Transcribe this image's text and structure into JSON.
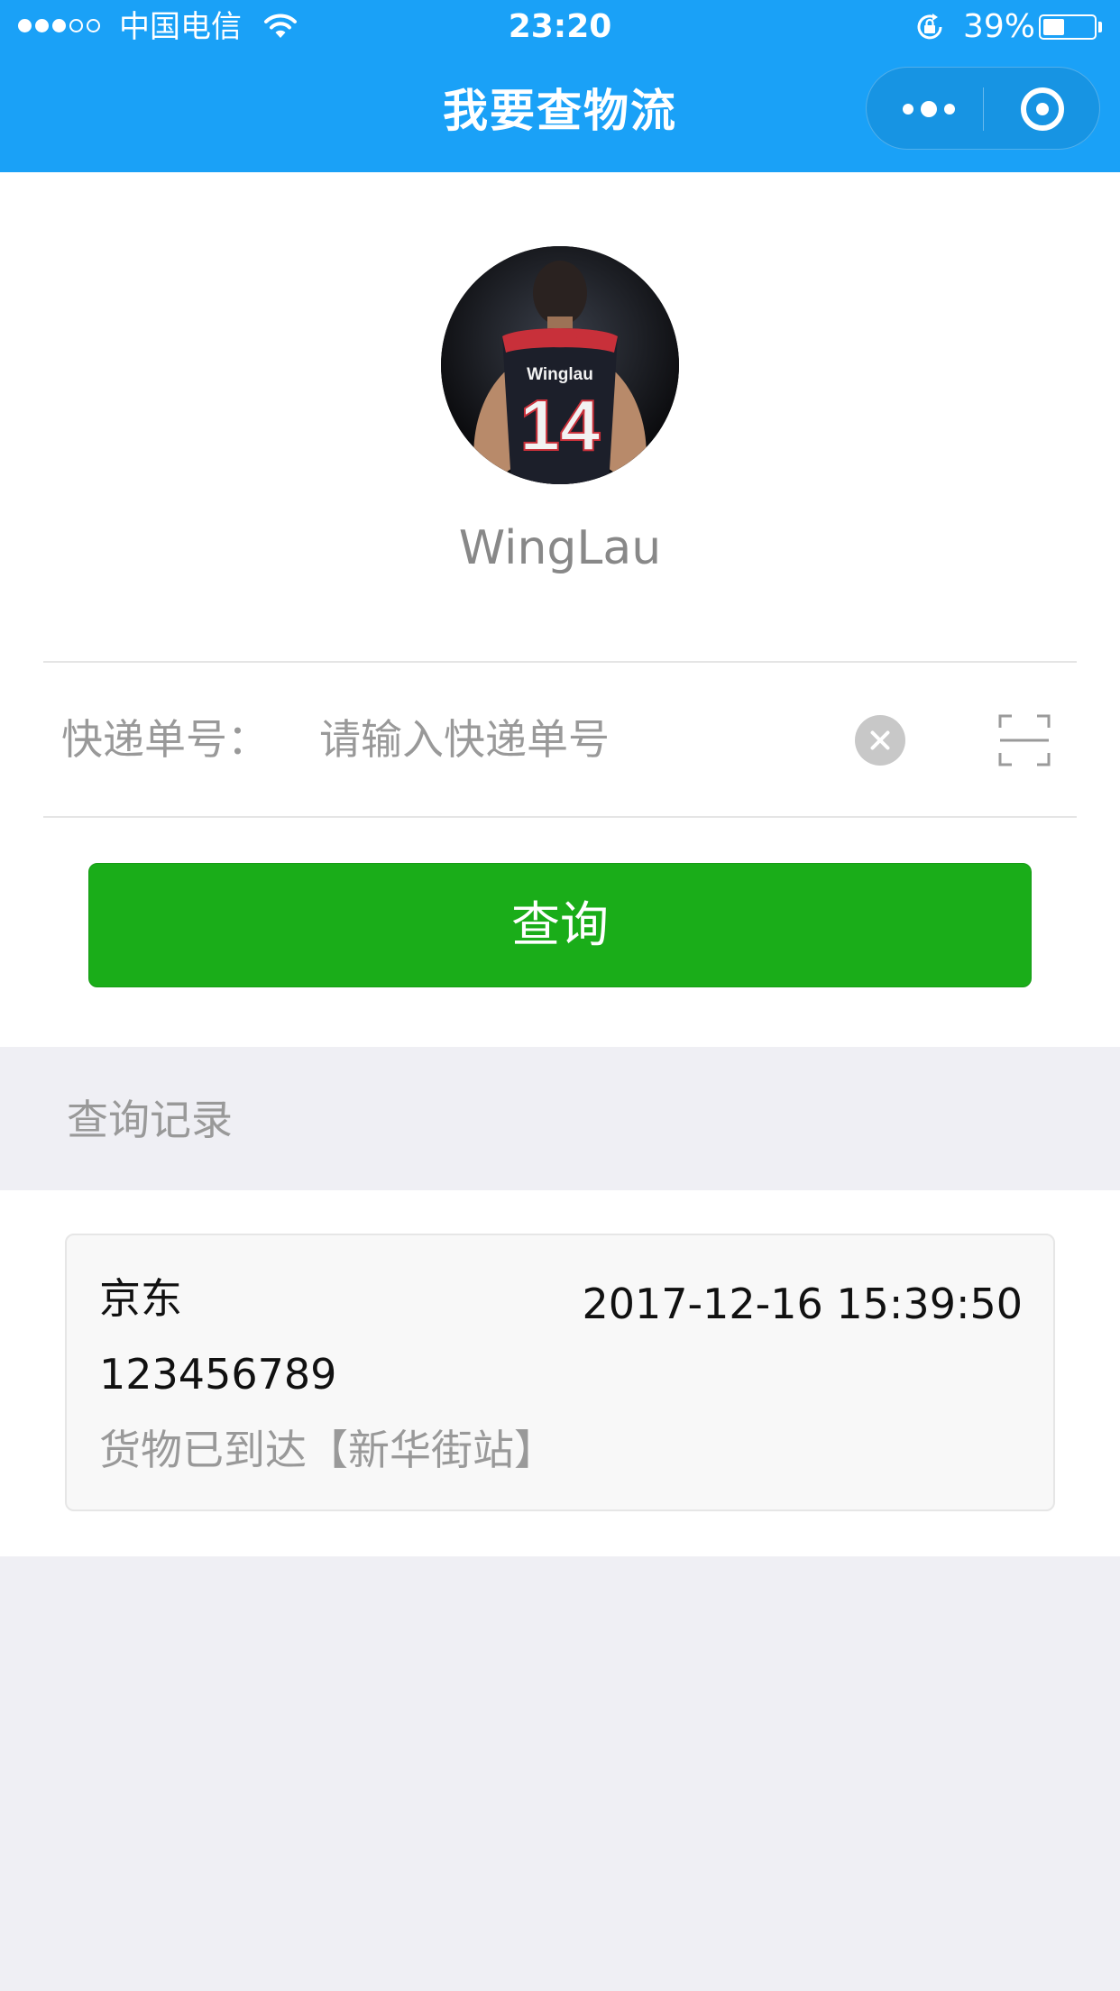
{
  "status_bar": {
    "carrier": "中国电信",
    "time": "23:20",
    "battery_percent": "39%",
    "battery_level": 0.39,
    "signal_bars_filled": 3,
    "signal_bars_total": 5
  },
  "nav": {
    "title": "我要查物流",
    "background_color": "#1aa1f7"
  },
  "profile": {
    "username": "WingLau",
    "avatar_jersey_name": "Winglau",
    "avatar_jersey_number": "14"
  },
  "search": {
    "label": "快递单号：",
    "placeholder": "请输入快递单号",
    "value": ""
  },
  "query_button": {
    "label": "查询",
    "color": "#1aad19"
  },
  "history": {
    "title": "查询记录",
    "records": [
      {
        "company": "京东",
        "time": "2017-12-16 15:39:50",
        "number": "123456789",
        "status": "货物已到达【新华街站】"
      }
    ]
  },
  "icons": [
    "wifi-icon",
    "rotation-lock-icon",
    "battery-icon",
    "more-icon",
    "close-icon",
    "clear-icon",
    "scan-icon"
  ]
}
